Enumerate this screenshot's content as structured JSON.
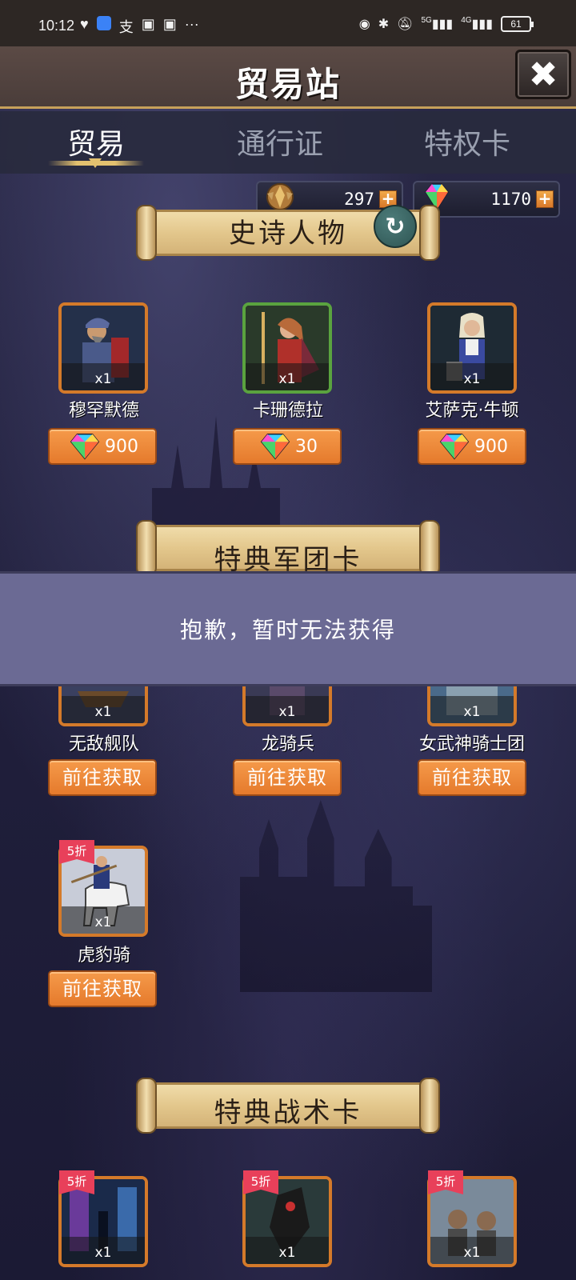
{
  "status_bar": {
    "time": "10:12",
    "battery": "61",
    "left_icons": [
      "heart-icon",
      "blue-app-icon",
      "alipay-icon",
      "message-icon",
      "message-icon",
      "more-icon"
    ],
    "right_icons": [
      "eye-icon",
      "bluetooth-icon",
      "mute-bell-icon",
      "signal-5g-icon",
      "signal-4g-icon"
    ],
    "network_5g": "5G",
    "network_4g": "4G"
  },
  "header": {
    "title": "贸易站",
    "close_icon": "close-icon"
  },
  "tabs": [
    {
      "label": "贸易",
      "active": true
    },
    {
      "label": "通行证",
      "active": false
    },
    {
      "label": "特权卡",
      "active": false
    }
  ],
  "currency": {
    "honor": {
      "value": "297",
      "icon": "honor-emblem-icon"
    },
    "gems": {
      "value": "1170",
      "icon": "rainbow-gem-icon"
    }
  },
  "sections": {
    "epic_heroes": {
      "title": "史诗人物",
      "items": [
        {
          "name": "穆罕默德",
          "qty": "x1",
          "price": "900",
          "frame": "orange"
        },
        {
          "name": "卡珊德拉",
          "qty": "x1",
          "price": "30",
          "frame": "green"
        },
        {
          "name": "艾萨克·牛顿",
          "qty": "x1",
          "price": "900",
          "frame": "orange"
        }
      ]
    },
    "legion_cards": {
      "title": "特典军团卡",
      "items": [
        {
          "name": "无敌舰队",
          "qty": "x1",
          "button": "前往获取"
        },
        {
          "name": "龙骑兵",
          "qty": "x1",
          "button": "前往获取"
        },
        {
          "name": "女武神骑士团",
          "qty": "x1",
          "button": "前往获取"
        },
        {
          "name": "虎豹骑",
          "qty": "x1",
          "button": "前往获取",
          "discount": "5折"
        }
      ]
    },
    "tactic_cards": {
      "title": "特典战术卡",
      "items": [
        {
          "qty": "x1",
          "discount": "5折"
        },
        {
          "qty": "x1",
          "discount": "5折"
        },
        {
          "qty": "x1",
          "discount": "5折"
        }
      ]
    }
  },
  "toast": {
    "message": "抱歉，暂时无法获得"
  },
  "colors": {
    "accent_orange": "#e57a2c",
    "frame_green": "#5aa33f",
    "toast_bg": "#6b6a94",
    "discount_red": "#e8405a",
    "tab_underline_gold": "#e3c16f"
  }
}
